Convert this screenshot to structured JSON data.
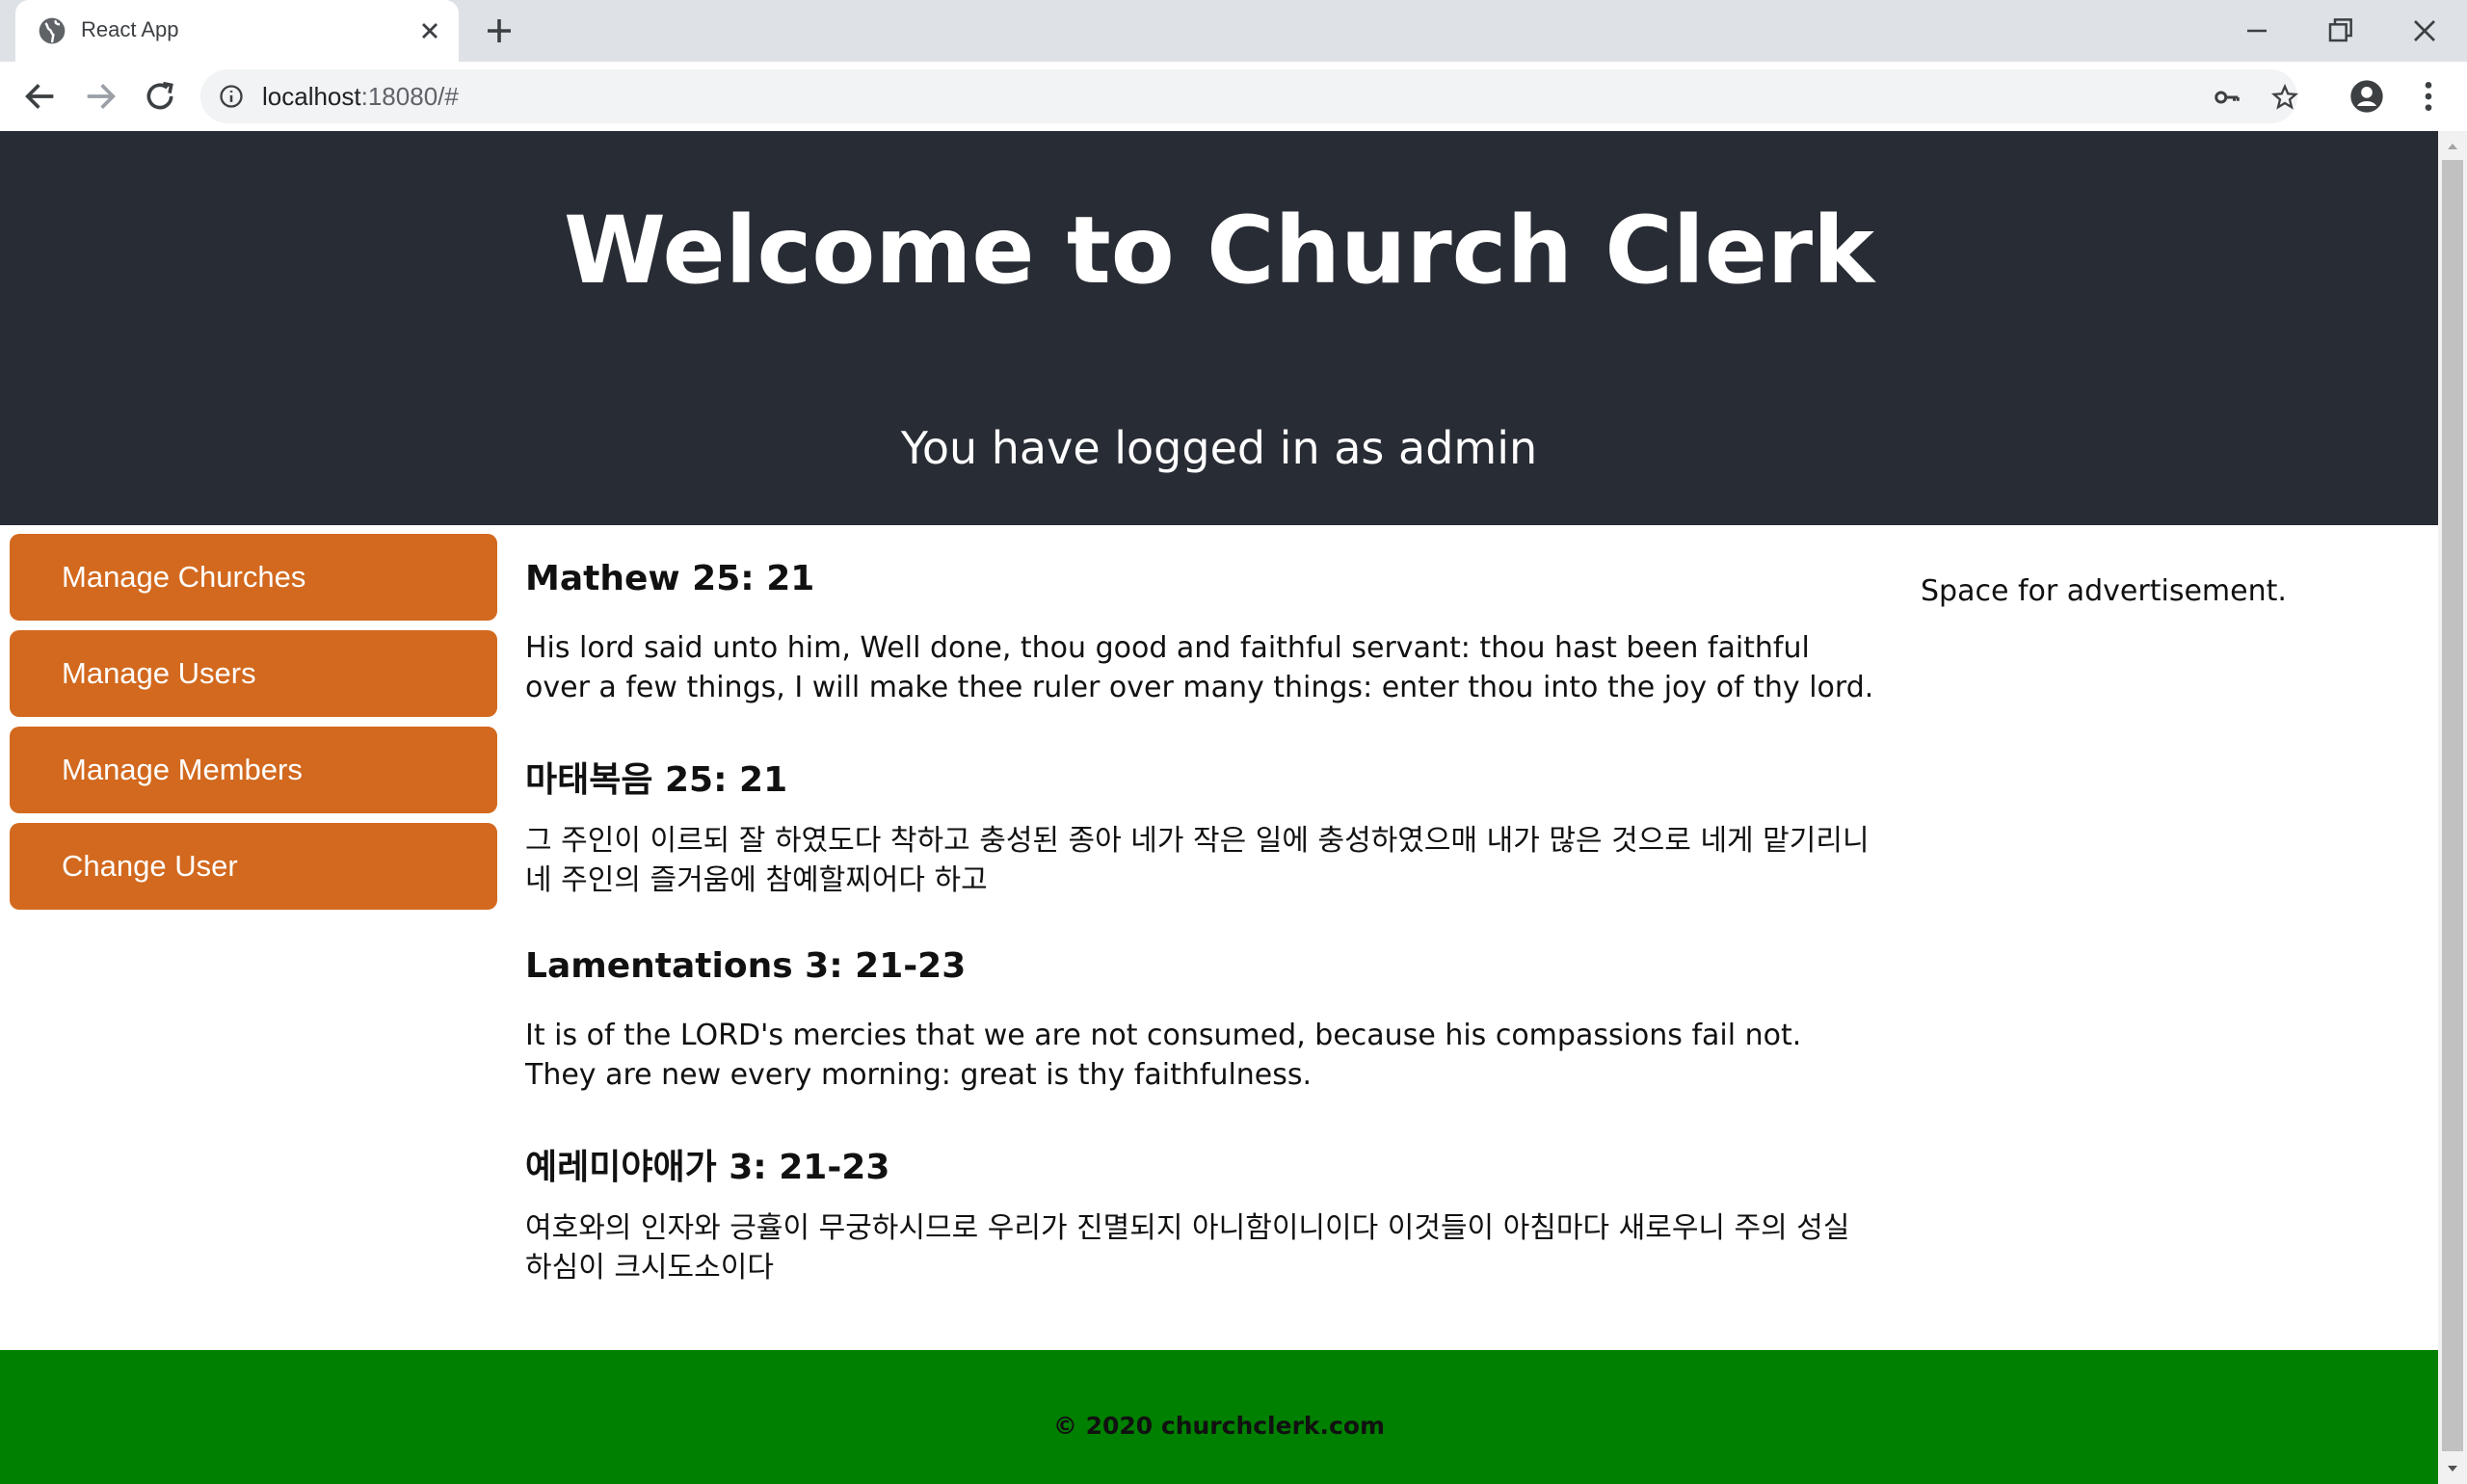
{
  "browser": {
    "tab_title": "React App",
    "url_host": "localhost",
    "url_rest": ":18080/#"
  },
  "header": {
    "title": "Welcome to Church Clerk",
    "logged_in": "You have logged in as admin"
  },
  "sidebar": {
    "items": [
      {
        "label": "Manage Churches"
      },
      {
        "label": "Manage Users"
      },
      {
        "label": "Manage Members"
      },
      {
        "label": "Change User"
      }
    ]
  },
  "verses": [
    {
      "ref": "Mathew 25: 21",
      "text": "His lord said unto him, Well done, thou good and faithful servant: thou hast been faithful over a few things, I will make thee ruler over many things: enter thou into the joy of thy lord."
    },
    {
      "ref": "마태복음 25: 21",
      "text": "그 주인이 이르되 잘 하였도다 착하고 충성된 종아 네가 작은 일에 충성하였으매 내가 많은 것으로 네게 맡기리니 네 주인의 즐거움에 참예할찌어다 하고"
    },
    {
      "ref": "Lamentations 3: 21-23",
      "text": "It is of the LORD's mercies that we are not consumed, because his compassions fail not. They are new every morning: great is thy faithfulness."
    },
    {
      "ref": "예레미야애가 3: 21-23",
      "text": "여호와의 인자와 긍휼이 무궁하시므로 우리가 진멸되지 아니함이니이다 이것들이 아침마다 새로우니 주의 성실하심이 크시도소이다"
    }
  ],
  "ad": {
    "text": "Space for advertisement."
  },
  "footer": {
    "copyright": "© 2020 churchclerk.com"
  },
  "colors": {
    "header_bg": "#282c34",
    "button_bg": "#d2691e",
    "footer_bg": "#008000"
  }
}
